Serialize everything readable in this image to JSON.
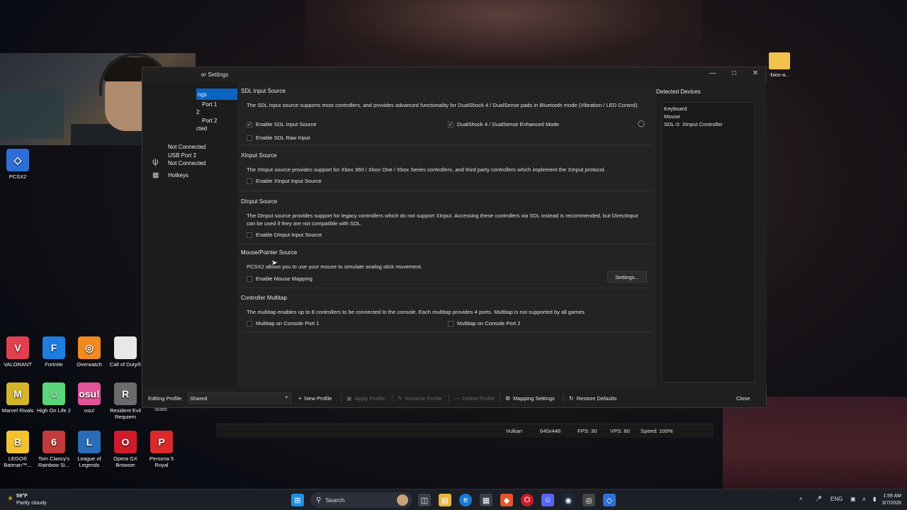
{
  "desktop": {
    "icons": [
      {
        "label": "PCSX2",
        "color": "#2d6fd6",
        "glyph": "◇",
        "icon": "pcsx2-icon"
      },
      {
        "label": "VALORANT",
        "color": "#e0404e",
        "glyph": "V",
        "icon": "valorant-icon"
      },
      {
        "label": "Fortnite",
        "color": "#1f7de0",
        "glyph": "F",
        "icon": "fortnite-icon"
      },
      {
        "label": "Overwatch",
        "color": "#f08a20",
        "glyph": "◎",
        "icon": "overwatch-icon"
      },
      {
        "label": "Call of Duty®",
        "color": "#e8e8e8",
        "glyph": "",
        "icon": "file-icon"
      },
      {
        "label": "Marvel Rivals",
        "color": "#d4b52a",
        "glyph": "M",
        "icon": "marvel-rivals-icon"
      },
      {
        "label": "High On Life 2",
        "color": "#5ad67a",
        "glyph": "☺",
        "icon": "high-on-life-icon"
      },
      {
        "label": "osu!",
        "color": "#e0559a",
        "glyph": "osu!",
        "icon": "osu-icon"
      },
      {
        "label": "Resident Evil Requiem",
        "color": "#6b6b6b",
        "glyph": "R",
        "icon": "resident-evil-icon"
      },
      {
        "label": "LEGO® Batman™...",
        "color": "#f2c230",
        "glyph": "B",
        "icon": "lego-batman-icon"
      },
      {
        "label": "Tom Clancy's Rainbow Si...",
        "color": "#c23a3a",
        "glyph": "6",
        "icon": "rainbow-six-icon"
      },
      {
        "label": "League of Legends",
        "color": "#2a6cb8",
        "glyph": "L",
        "icon": "league-icon"
      },
      {
        "label": "Opera GX Browser",
        "color": "#d01c2a",
        "glyph": "O",
        "icon": "opera-gx-icon"
      },
      {
        "label": "Persona 5 Royal",
        "color": "#d92b2b",
        "glyph": "P",
        "icon": "persona-icon"
      }
    ],
    "folder_label": "-bios-a...",
    "skate_label": "skate."
  },
  "window": {
    "title": "er Settings",
    "sidebar": [
      {
        "label": "ngs",
        "active": true
      },
      {
        "label": "Port 1"
      },
      {
        "label": "2"
      },
      {
        "label": "Port 2"
      },
      {
        "label": "cted"
      },
      {
        "label": "Not Connected"
      },
      {
        "label": "USB Port 2"
      },
      {
        "label": "Not Connected"
      },
      {
        "label": "Hotkeys"
      }
    ],
    "sections": {
      "sdl": {
        "title": "SDL Input Source",
        "desc": "The SDL input source supports most controllers, and provides advanced functionality for DualShock 4 / DualSense pads in Bluetooth mode (Vibration / LED Control).",
        "enable_sdl": "Enable SDL Input Source",
        "enable_raw": "Enable SDL Raw Input",
        "dualsense": "DualShock 4 / DualSense Enhanced Mode"
      },
      "xinput": {
        "title": "XInput Source",
        "desc": "The XInput source provides support for Xbox 360 / Xbox One / Xbox Series controllers, and third party controllers which implement the XInput protocol.",
        "enable": "Enable XInput Input Source"
      },
      "dinput": {
        "title": "DInput Source",
        "desc": "The DInput source provides support for legacy controllers which do not support XInput. Accessing these controllers via SDL instead is recommended, but DirectInput can be used if they are not compatible with SDL.",
        "enable": "Enable DInput Input Source"
      },
      "mouse": {
        "title": "Mouse/Pointer Source",
        "desc": "PCSX2 allows you to use your mouse to simulate analog stick movement.",
        "enable": "Enable Mouse Mapping",
        "settings_btn": "Settings..."
      },
      "multitap": {
        "title": "Controller Multitap",
        "desc": "The multitap enables up to 8 controllers to be connected to the console. Each multitap provides 4 ports. Multitap is not supported by all games.",
        "port1": "Multitap on Console Port 1",
        "port2": "Multitap on Console Port 2"
      }
    },
    "devices": {
      "title": "Detected Devices",
      "items": [
        "Keyboard",
        "Mouse",
        "SDL-0: XInput Controller"
      ]
    },
    "bottom": {
      "editing_profile_label": "Editing Profile:",
      "profile_value": "Shared",
      "new_profile": "New Profile",
      "apply_profile": "Apply Profile",
      "rename_profile": "Rename Profile",
      "delete_profile": "Delete Profile",
      "mapping_settings": "Mapping Settings",
      "restore_defaults": "Restore Defaults",
      "close": "Close"
    }
  },
  "statusbar": {
    "renderer": "Vulkan",
    "resolution": "640x448",
    "fps": "FPS: 30",
    "vps": "VPS: 60",
    "speed": "Speed: 100%"
  },
  "taskbar": {
    "weather_temp": "59°F",
    "weather_desc": "Partly cloudy",
    "search_placeholder": "Search",
    "lang": "ENG",
    "time": "1:59 AM",
    "date": "3/7/2026"
  }
}
